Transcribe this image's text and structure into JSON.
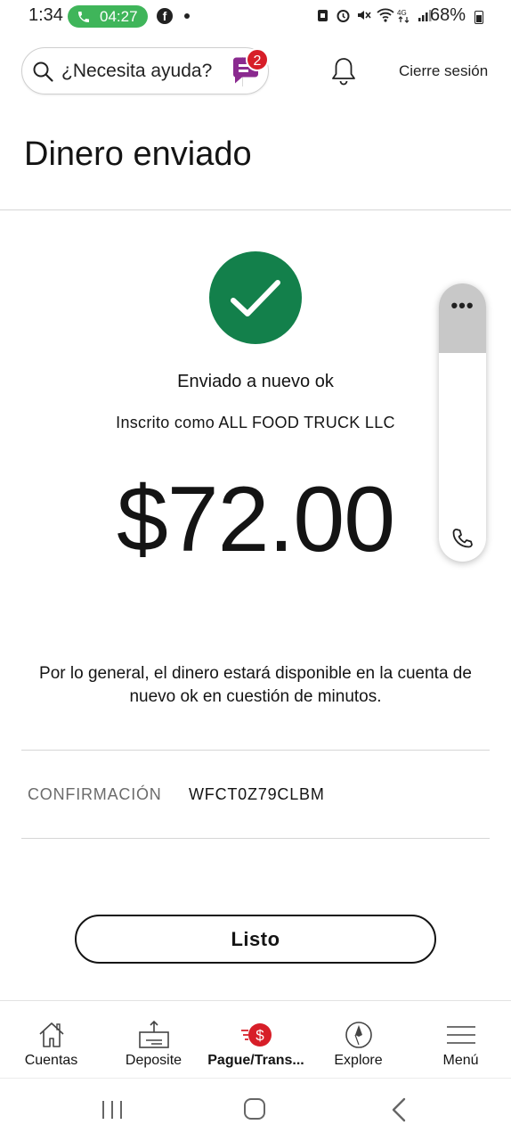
{
  "status_bar": {
    "time": "1:34",
    "call_timer": "04:27",
    "battery_percent": "68%"
  },
  "header": {
    "search_placeholder": "¿Necesita ayuda?",
    "chat_badge_count": "2",
    "logout_label": "Cierre sesión"
  },
  "page": {
    "title": "Dinero enviado",
    "sent_to": "Enviado a nuevo ok",
    "enrolled_as": "Inscrito como ALL FOOD TRUCK LLC",
    "amount": "$72.00",
    "note": "Por lo general, el dinero estará disponible en la cuenta de nuevo ok en cuestión de minutos.",
    "confirmation_label": "CONFIRMACIÓN",
    "confirmation_value": "WFCT0Z79CLBM",
    "done_label": "Listo"
  },
  "floating_widget": {
    "more_label": "•••"
  },
  "bottom_nav": {
    "items": [
      {
        "label": "Cuentas",
        "icon": "house-icon"
      },
      {
        "label": "Deposite",
        "icon": "deposit-icon"
      },
      {
        "label": "Pague/Trans...",
        "icon": "pay-transfer-icon",
        "active": true
      },
      {
        "label": "Explore",
        "icon": "compass-icon"
      },
      {
        "label": "Menú",
        "icon": "menu-icon"
      }
    ]
  },
  "colors": {
    "success_green": "#13804b",
    "brand_red": "#d71e28",
    "call_pill_green": "#3fb55a",
    "chat_purple": "#8a2a8f"
  }
}
